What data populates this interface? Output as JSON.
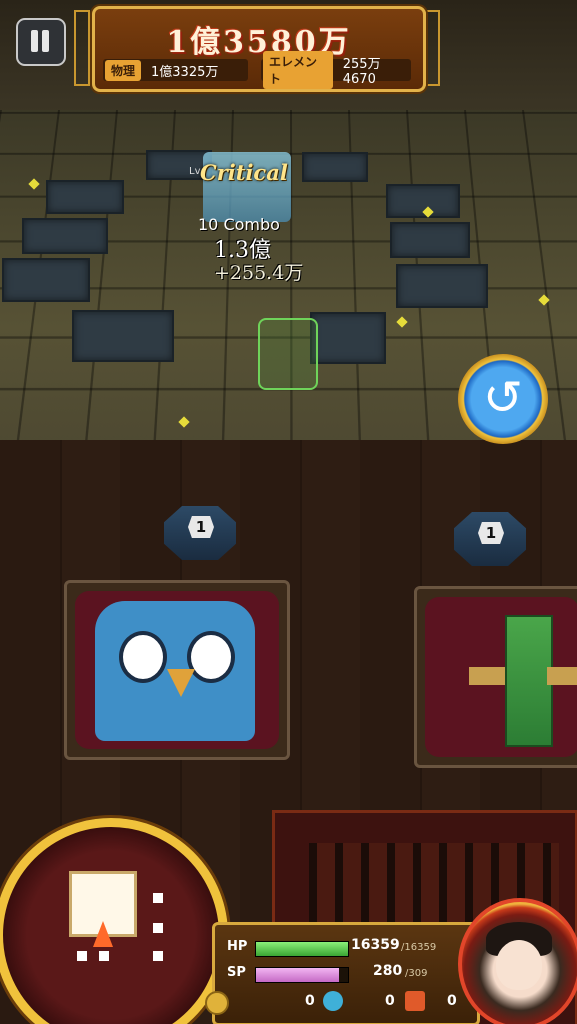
{
  "hud": {
    "total_damage": "1億3580万",
    "physical_label": "物理",
    "physical_value": "1億3325万",
    "element_label": "エレメント",
    "element_value": "255万4670"
  },
  "battle": {
    "lv_label": "Lv",
    "critical_label": "Critical",
    "combo_text": "10 Combo",
    "damage_main": "1.3億",
    "damage_bonus": "+255.4万"
  },
  "map": {
    "marker_left": "1",
    "marker_right": "1"
  },
  "status": {
    "hp_label": "HP",
    "hp_current": "16359",
    "hp_max": "/16359",
    "hp_fraction": 1.0,
    "sp_label": "SP",
    "sp_current": "280",
    "sp_max": "/309",
    "sp_fraction": 0.906,
    "res_gold": "0",
    "res_blue": "0",
    "res_chest": "0"
  },
  "colors": {
    "gold_frame": "#f0c23c",
    "hp_green": "#3aa534",
    "sp_pink": "#c56ac5"
  }
}
